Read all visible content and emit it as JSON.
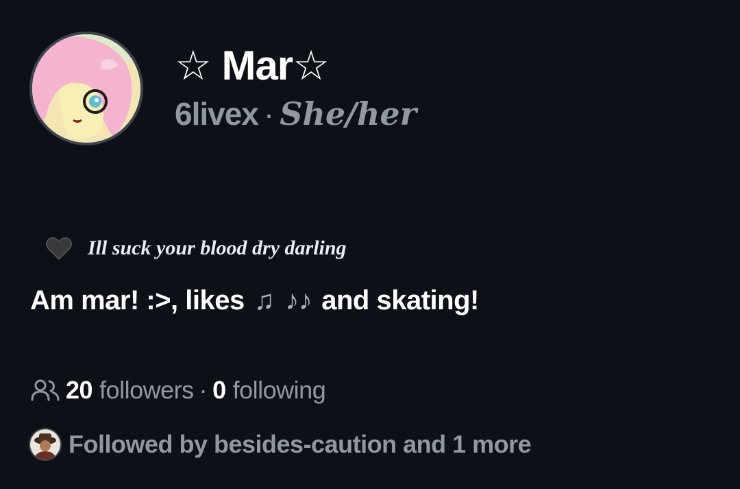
{
  "profile": {
    "display_name": "☆ Mar☆",
    "username": "6livex",
    "separator": "·",
    "pronouns": "She/her",
    "avatar_icon": "pink-pony-avatar"
  },
  "status": {
    "emoji": "black-heart-icon",
    "text": "Ill suck your blood dry darling"
  },
  "bio": {
    "before": "Am mar! :>, likes",
    "note1": "♫",
    "note2": "♪♪",
    "after": "and skating!"
  },
  "follow": {
    "followers_count": "20",
    "followers_label": "followers",
    "separator": "·",
    "following_count": "0",
    "following_label": "following"
  },
  "followed_by": {
    "text": "Followed by besides-caution and 1 more",
    "avatar_icon": "follower-avatar"
  },
  "colors": {
    "background": "#0d1117",
    "primary_text": "#e6edf3",
    "muted_text": "#9198a1"
  }
}
